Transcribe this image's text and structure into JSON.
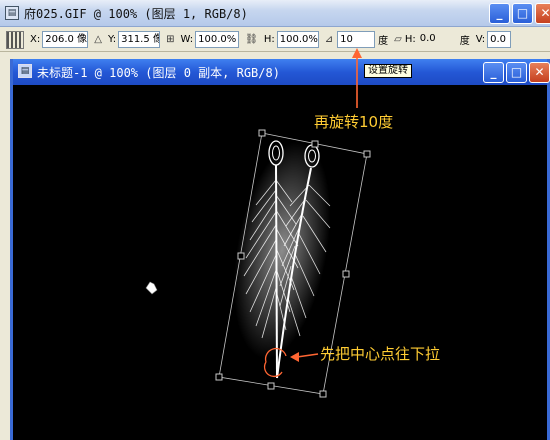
{
  "back_window": {
    "title": "府025.GIF @ 100% (图层 1, RGB/8)",
    "icon": "document-icon"
  },
  "window_buttons": {
    "minimize": "_",
    "maximize": "□",
    "close": "✕"
  },
  "options_bar": {
    "x_label": "X:",
    "x_value": "206.0 像",
    "y_label": "Y:",
    "y_value": "311.5 像",
    "w_label": "W:",
    "w_value": "100.0%",
    "h_label": "H:",
    "h_value": "100.0%",
    "rotate_value": "10",
    "rotate_unit": "度",
    "hskew_label": "H:",
    "hskew_value": "0.0",
    "hskew_unit": "度",
    "vskew_label": "V:",
    "vskew_value": "0.0"
  },
  "doc_window": {
    "title": "未标题-1 @ 100% (图层 0 副本, RGB/8)",
    "icon": "document-icon"
  },
  "tooltip": "设置旋转",
  "annotations": {
    "rotate_note": "再旋转10度",
    "center_note": "先把中心点往下拉"
  },
  "colors": {
    "annotation": "#ffcc33",
    "arrow": "#ff6633",
    "titlebar_active": "#2458d6"
  }
}
